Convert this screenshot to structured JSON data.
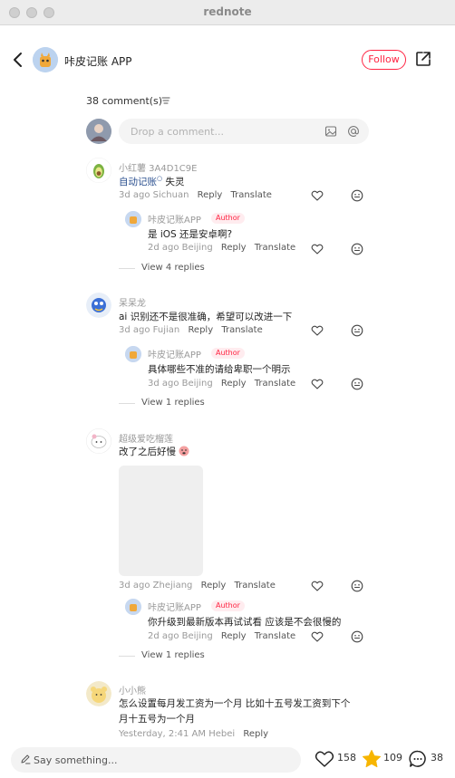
{
  "window": {
    "title": "rednote"
  },
  "header": {
    "author_name": "咔皮记账 APP",
    "follow_label": "Follow"
  },
  "comments_header": {
    "count": "38 comment(s)"
  },
  "composer": {
    "placeholder": "Drop a comment..."
  },
  "comments": [
    {
      "username": "小红薯 3A4D1C9E",
      "text_link": "自动记账",
      "text_rest": " 失灵",
      "time": "3d ago",
      "location": "Sichuan",
      "reply_label": "Reply",
      "translate_label": "Translate",
      "reply": {
        "username": "咔皮记账APP",
        "badge": "Author",
        "text": "是 iOS 还是安卓啊?",
        "time": "2d ago",
        "location": "Beijing",
        "reply_label": "Reply",
        "translate_label": "Translate"
      },
      "view_replies": "View 4 replies"
    },
    {
      "username": "呆呆龙",
      "text": "ai 识别还不是很准确，希望可以改进一下",
      "time": "3d ago",
      "location": "Fujian",
      "reply_label": "Reply",
      "translate_label": "Translate",
      "reply": {
        "username": "咔皮记账APP",
        "badge": "Author",
        "text": "具体哪些不准的请给卑职一个明示",
        "time": "3d ago",
        "location": "Beijing",
        "reply_label": "Reply",
        "translate_label": "Translate"
      },
      "view_replies": "View 1 replies"
    },
    {
      "username": "超级爱吃榴莲",
      "text": "改了之后好慢",
      "time": "3d ago",
      "location": "Zhejiang",
      "reply_label": "Reply",
      "translate_label": "Translate",
      "reply": {
        "username": "咔皮记账APP",
        "badge": "Author",
        "text": "你升级到最新版本再试试看 应该是不会很慢的",
        "time": "2d ago",
        "location": "Beijing",
        "reply_label": "Reply",
        "translate_label": "Translate"
      },
      "view_replies": "View 1 replies"
    },
    {
      "username": "小小熊",
      "text_line1": "怎么设置每月发工资为一个月  比如十五号发工资到下个",
      "text_line2": "月十五号为一个月",
      "time": "Yesterday, 2:41 AM",
      "location": "Hebei",
      "reply_label": "Reply"
    }
  ],
  "bottom_bar": {
    "placeholder": "Say something...",
    "likes": "158",
    "stars": "109",
    "comments": "38"
  },
  "colors": {
    "accent": "#ff2442",
    "link": "#2a4f8f",
    "star": "#f7b500"
  }
}
